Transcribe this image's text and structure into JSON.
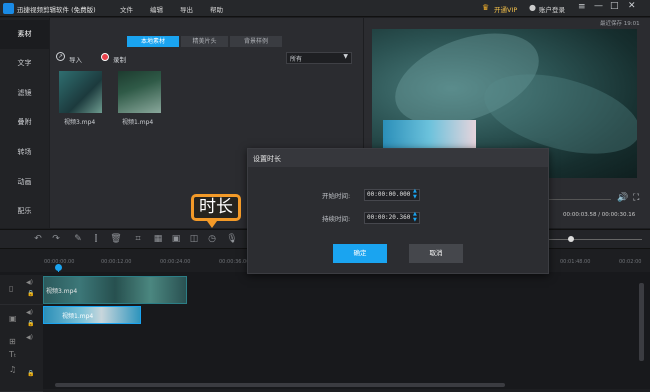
{
  "app": {
    "title": "迅捷视频剪辑软件 (免费版)",
    "menu": [
      "文件",
      "编辑",
      "导出",
      "帮助"
    ],
    "vip": "开通VIP",
    "login": "账户登录",
    "autosave": "最近保存 19:01"
  },
  "sidebar": {
    "items": [
      "素材",
      "文字",
      "滤镜",
      "叠附",
      "转场",
      "动画",
      "配乐"
    ],
    "active": "素材"
  },
  "media": {
    "tabs": [
      "本地素材",
      "精美片头",
      "背景样例"
    ],
    "import_label": "导入",
    "record_label": "录制",
    "filter_value": "所有",
    "files": [
      {
        "name": "视频3.mp4"
      },
      {
        "name": "视频1.mp4"
      }
    ]
  },
  "preview": {
    "time": "00:00:03.58 / 00:00:30.16"
  },
  "timeline": {
    "ticks": [
      "00:00:00.00",
      "00:00:12.00",
      "00:00:24.00",
      "00:00:36.00",
      "00:01:48.00",
      "00:02:00"
    ],
    "clips": [
      {
        "name": "视频3.mp4"
      },
      {
        "name": "视频1.mp4"
      }
    ]
  },
  "dialog": {
    "title": "设置时长",
    "start_label": "开始时间:",
    "start_value": "00:00:00.000",
    "duration_label": "持续时间:",
    "duration_value": "00:00:20.360",
    "ok": "确定",
    "cancel": "取消"
  },
  "callout": "时长",
  "colors": {
    "accent": "#1aa4f0",
    "callout": "#f39a28"
  }
}
